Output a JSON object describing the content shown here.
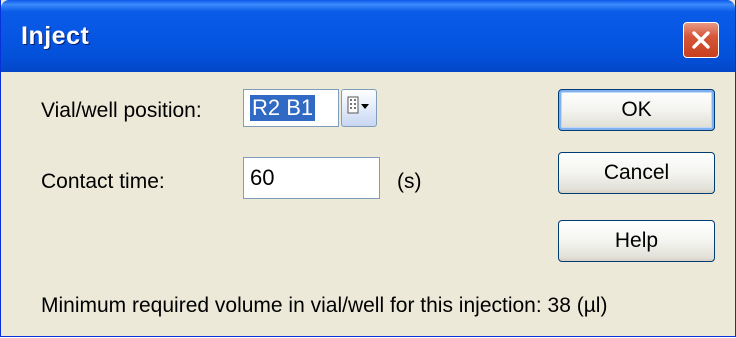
{
  "window": {
    "title": "Inject",
    "close_icon": "close-icon"
  },
  "vial": {
    "label": "Vial/well position:",
    "value": "R2 B1",
    "dropdown_icon": "grid-dropdown-icon"
  },
  "contact": {
    "label": "Contact time:",
    "value": "60",
    "unit": "(s)"
  },
  "buttons": {
    "ok": "OK",
    "cancel": "Cancel",
    "help": "Help"
  },
  "footer": {
    "message": "Minimum required volume in vial/well for this injection: 38 (µl)"
  },
  "colors": {
    "titlebar": "#0656e3",
    "dialog_bg": "#ece9d8",
    "selection": "#316ac5",
    "close_button": "#c8401f"
  }
}
